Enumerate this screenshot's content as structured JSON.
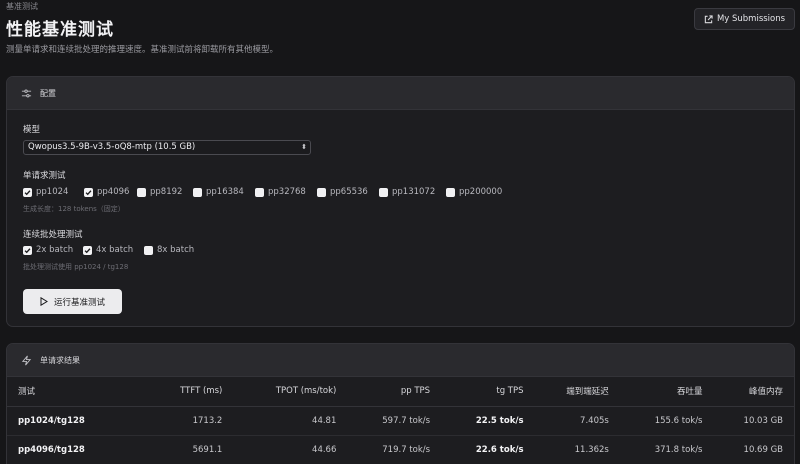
{
  "breadcrumb": "基准测试",
  "title": "性能基准测试",
  "description": "测量单请求和连续批处理的推理速度。基准测试前将卸载所有其他模型。",
  "submissions_button": "My Submissions",
  "config": {
    "header": "配置",
    "model_label": "模型",
    "model_value": "Qwopus3.5-9B-v3.5-oQ8-mtp (10.5 GB)",
    "single_label": "单请求测试",
    "single_options": [
      {
        "label": "pp1024",
        "checked": true
      },
      {
        "label": "pp4096",
        "checked": true
      },
      {
        "label": "pp8192",
        "checked": false
      },
      {
        "label": "pp16384",
        "checked": false
      },
      {
        "label": "pp32768",
        "checked": false
      },
      {
        "label": "pp65536",
        "checked": false
      },
      {
        "label": "pp131072",
        "checked": false
      },
      {
        "label": "pp200000",
        "checked": false
      }
    ],
    "single_hint": "生成长度：128 tokens（固定）",
    "batch_label": "连续批处理测试",
    "batch_options": [
      {
        "label": "2x batch",
        "checked": true
      },
      {
        "label": "4x batch",
        "checked": true
      },
      {
        "label": "8x batch",
        "checked": false
      }
    ],
    "batch_hint": "批处理测试使用 pp1024 / tg128",
    "run_button": "运行基准测试"
  },
  "results": {
    "header": "单请求结果",
    "columns": [
      "测试",
      "TTFT (ms)",
      "TPOT (ms/tok)",
      "pp TPS",
      "tg TPS",
      "端到端延迟",
      "吞吐量",
      "峰值内存"
    ],
    "rows": [
      [
        "pp1024/tg128",
        "1713.2",
        "44.81",
        "597.7 tok/s",
        "22.5 tok/s",
        "7.405s",
        "155.6 tok/s",
        "10.03 GB"
      ],
      [
        "pp4096/tg128",
        "5691.1",
        "44.66",
        "719.7 tok/s",
        "22.6 tok/s",
        "11.362s",
        "371.8 tok/s",
        "10.69 GB"
      ]
    ]
  }
}
